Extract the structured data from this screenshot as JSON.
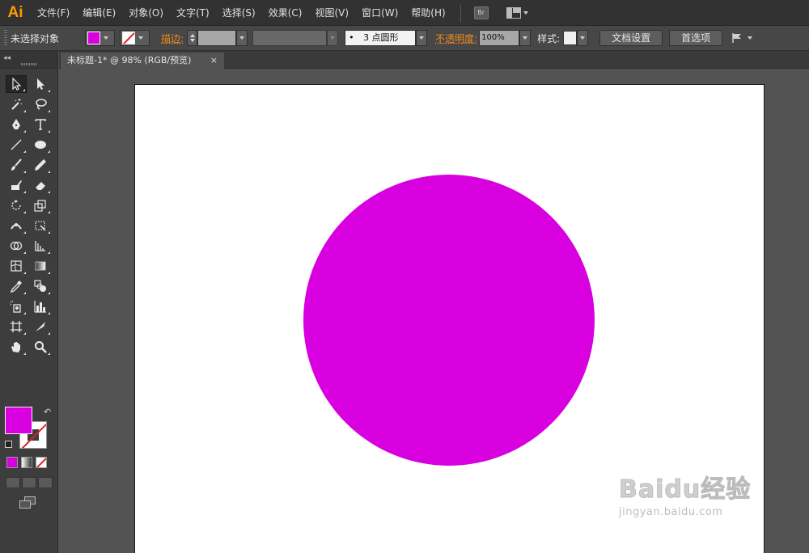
{
  "app": {
    "logo": "Ai"
  },
  "menu": [
    "文件(F)",
    "编辑(E)",
    "对象(O)",
    "文字(T)",
    "选择(S)",
    "效果(C)",
    "视图(V)",
    "窗口(W)",
    "帮助(H)"
  ],
  "menubar_icons": {
    "bridge": "Br"
  },
  "control": {
    "selection_status": "未选择对象",
    "fill_color": "#d900e0",
    "stroke_label": "描边:",
    "brush_value": "3 点圆形",
    "brush_bullet": "•",
    "opacity_label": "不透明度:",
    "opacity_value": "100%",
    "style_label": "样式:",
    "doc_setup_button": "文档设置",
    "preferences_button": "首选项"
  },
  "document_tab": {
    "title": "未标题-1* @ 98% (RGB/预览)",
    "close": "×"
  },
  "tools": {
    "fill_color": "#d900e0",
    "stroke": "none"
  },
  "canvas": {
    "circle_color": "#d900e0"
  },
  "watermark": {
    "brand": "Baidu经验",
    "url": "jingyan.baidu.com"
  }
}
